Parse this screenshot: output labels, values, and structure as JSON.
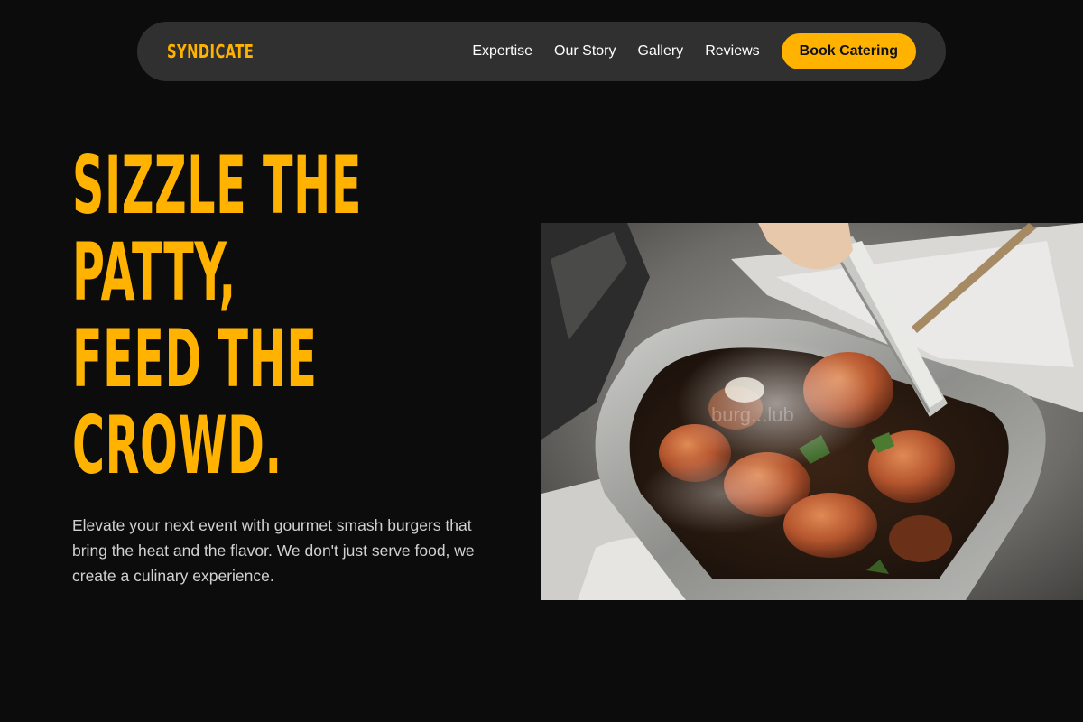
{
  "brand": {
    "name": "SYNDICATE"
  },
  "nav": {
    "links": [
      "Expertise",
      "Our Story",
      "Gallery",
      "Reviews"
    ],
    "cta_label": "Book Catering"
  },
  "hero": {
    "headline_lines": [
      "SIZZLE THE",
      "PATTY,",
      "FEED THE",
      "CROWD."
    ],
    "description": "Elevate your next event with gourmet smash burgers that bring the heat and the flavor. We don't just serve food, we create a culinary experience.",
    "image_watermark": "burg...lub"
  },
  "colors": {
    "background": "#0c0c0c",
    "nav_background": "#303030",
    "accent": "#ffb300",
    "body_text": "#d2d2d2"
  }
}
